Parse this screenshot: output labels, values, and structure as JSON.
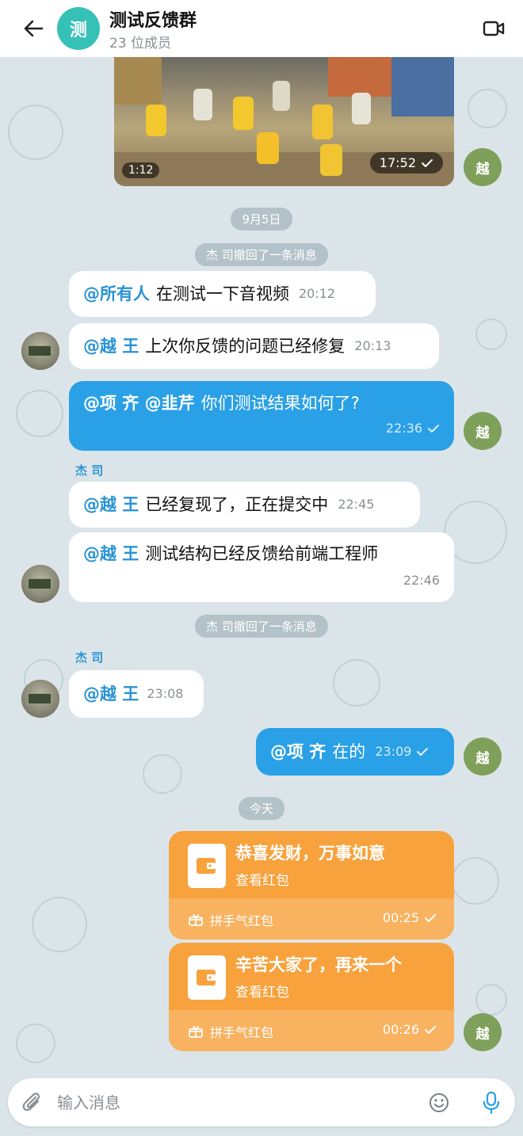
{
  "header": {
    "back_label": "←",
    "avatar_char": "测",
    "title": "测试反馈群",
    "subtitle": "23 位成员"
  },
  "media": {
    "duration": "1:12",
    "time": "17:52"
  },
  "my_avatar_char": "越",
  "dates": {
    "d1": "9月5日",
    "today": "今天"
  },
  "system": {
    "recall1": "杰 司撤回了一条消息",
    "recall2": "杰 司撤回了一条消息"
  },
  "messages": [
    {
      "mention": "@所有人",
      "text": "在测试一下音视频",
      "time": "20:12"
    },
    {
      "mention": "@越 王",
      "text": "上次你反馈的问题已经修复",
      "time": "20:13"
    },
    {
      "mention": "@项 齐 @韭芹",
      "text": "你们测试结果如何了?",
      "time": "22:36"
    },
    {
      "sender": "杰 司",
      "mention": "@越 王",
      "text": "已经复现了，正在提交中",
      "time": "22:45"
    },
    {
      "mention": "@越 王",
      "text": "测试结构已经反馈给前端工程师",
      "time": "22:46"
    },
    {
      "sender": "杰 司",
      "mention": "@越 王",
      "text": "",
      "time": "23:08"
    },
    {
      "mention": "@项 齐",
      "text": "在的",
      "time": "23:09"
    }
  ],
  "red_packets": [
    {
      "title": "恭喜发财，万事如意",
      "sub": "查看红包",
      "type": "拼手气红包",
      "time": "00:25"
    },
    {
      "title": "辛苦大家了，再来一个",
      "sub": "查看红包",
      "type": "拼手气红包",
      "time": "00:26"
    }
  ],
  "composer": {
    "placeholder": "输入消息"
  },
  "colors": {
    "accent": "#2aa0e6",
    "mention": "#2893d4",
    "red_packet": "#f7a23d",
    "chat_bg": "#dbe5e9",
    "group_avatar": "#36c1b6",
    "user_avatar": "#7fa05a"
  },
  "icons": [
    "back-arrow-icon",
    "video-call-icon",
    "wallet-icon",
    "gift-icon",
    "check-icon",
    "paperclip-icon",
    "emoji-icon",
    "microphone-icon"
  ]
}
